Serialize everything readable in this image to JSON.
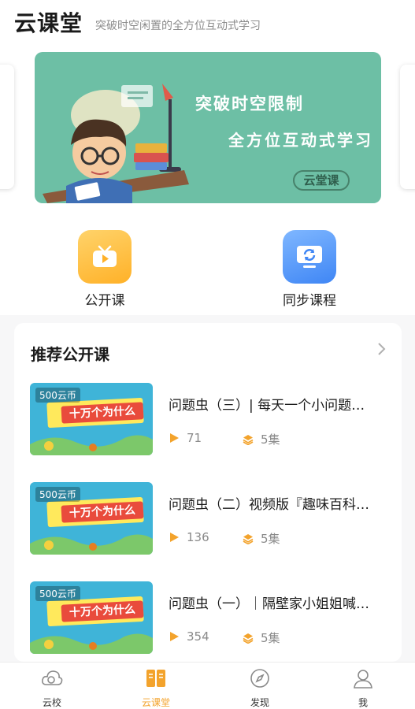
{
  "header": {
    "title": "云课堂",
    "subtitle": "突破时空闲置的全方位互动式学习"
  },
  "banner": {
    "line1": "突破时空限制",
    "line2": "全方位互动式学习",
    "logo_text": "云堂课",
    "background_color": "#6dbfa5"
  },
  "entries": [
    {
      "label": "公开课",
      "icon": "play-tv-icon",
      "color": "#ffb128"
    },
    {
      "label": "同步课程",
      "icon": "sync-screen-icon",
      "color": "#3f86f5"
    }
  ],
  "recommend": {
    "title": "推荐公开课",
    "more_icon": "chevron-right-icon",
    "courses": [
      {
        "price": "500云币",
        "thumb_text": "十万个为什么",
        "title": "问题虫（三）| 每天一个小问题…",
        "plays": "71",
        "episodes": "5集"
      },
      {
        "price": "500云币",
        "thumb_text": "十万个为什么",
        "title": "问题虫（二）视频版『趣味百科…",
        "plays": "136",
        "episodes": "5集"
      },
      {
        "price": "500云币",
        "thumb_text": "十万个为什么",
        "title": "问题虫（一）｜隔壁家小姐姐喊…",
        "plays": "354",
        "episodes": "5集"
      }
    ]
  },
  "tabbar": {
    "active_color": "#f3a32c",
    "tabs": [
      {
        "label": "云校",
        "icon": "cloud-school-icon",
        "active": false
      },
      {
        "label": "云课堂",
        "icon": "book-icon",
        "active": true
      },
      {
        "label": "发现",
        "icon": "compass-icon",
        "active": false
      },
      {
        "label": "我",
        "icon": "user-icon",
        "active": false
      }
    ]
  }
}
